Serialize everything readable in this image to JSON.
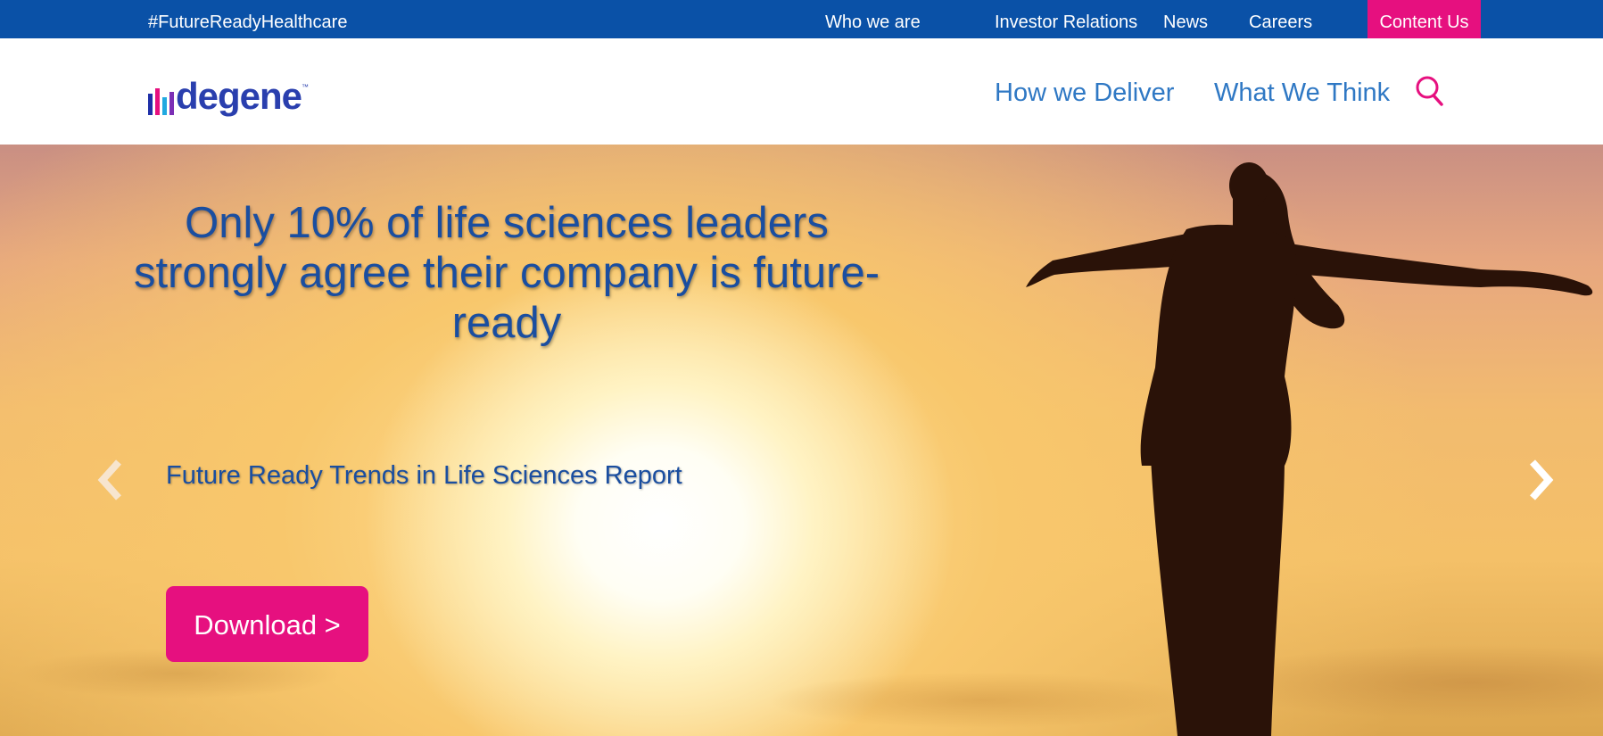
{
  "topbar": {
    "hashtag": "#FutureReadyHealthcare",
    "links": [
      "Who we are",
      "Investor Relations",
      "News",
      "Careers"
    ],
    "contact_label": "Content Us",
    "background": "#0a51a7",
    "contact_color": "#e6107f"
  },
  "header": {
    "logo_text": "degene",
    "logo_tm": "™",
    "nav": [
      "How we Deliver",
      "What We Think"
    ],
    "search_icon": "search-icon"
  },
  "hero": {
    "headline": "Only 10% of life sciences leaders strongly agree their company is future-ready",
    "subline": "Future Ready Trends in Life Sciences Report",
    "cta_label": "Download >",
    "prev_icon": "chevron-left-icon",
    "next_icon": "chevron-right-icon",
    "text_color": "#1a4ea0",
    "cta_color": "#e6107f"
  }
}
